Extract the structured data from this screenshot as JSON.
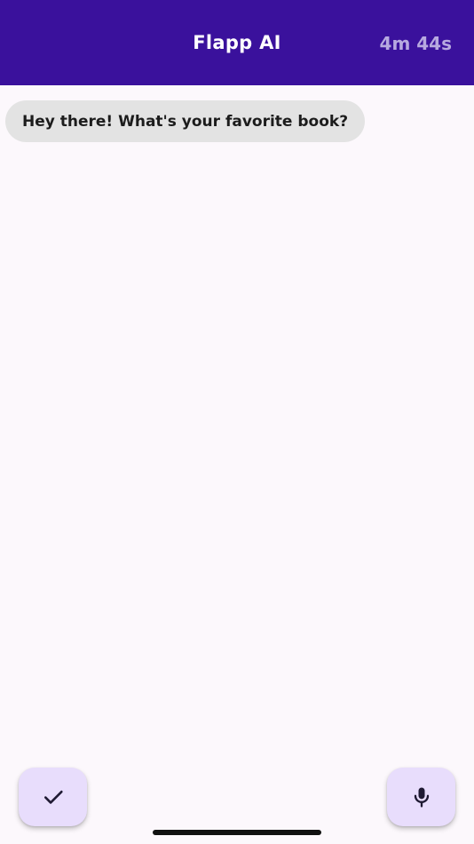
{
  "header": {
    "title": "Flapp AI",
    "timer": "4m 44s"
  },
  "messages": [
    {
      "sender": "ai",
      "text": "Hey there! What's your favorite book?"
    }
  ],
  "actions": {
    "finish_icon": "check-icon",
    "mic_icon": "microphone-icon"
  },
  "colors": {
    "header_bg": "#3a119c",
    "timer_text": "#b7a9e0",
    "bubble_bg": "#e3e3e3",
    "fab_bg": "#e8ddfc",
    "page_bg": "#fcf8fc"
  }
}
